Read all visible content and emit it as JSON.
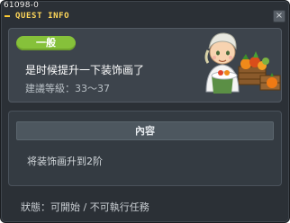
{
  "window": {
    "id_label": "61098-0",
    "title": "QUEST INFO",
    "close_label": "×"
  },
  "quest": {
    "badge": "一般",
    "name": "是时候提升一下装饰画了",
    "level_requirement": "建議等級：33～37"
  },
  "content": {
    "header": "內容",
    "description": "将装饰画升到2阶"
  },
  "status": {
    "text": "狀態：可開始 / 不可執行任務"
  },
  "colors": {
    "badge": "#86c13a",
    "title": "#ffd75a",
    "panel": "#3d444c"
  }
}
